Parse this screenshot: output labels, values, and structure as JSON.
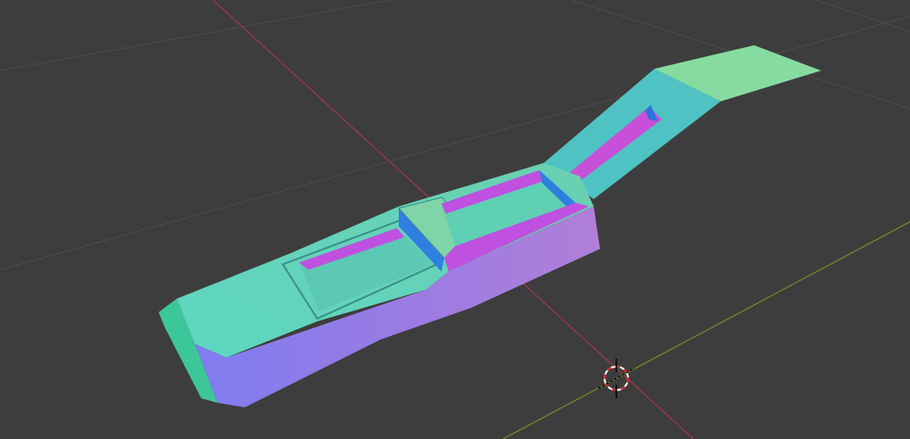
{
  "viewport": {
    "background": "#3d3d3d",
    "grid_color": "#4b4b4b",
    "x_axis_color": "#9a3a44",
    "y_axis_color": "#6b8a2c"
  },
  "model": {
    "shading": "normal-map",
    "top_color": "#62d0b8",
    "side_color": "#9a7be4",
    "wall_color": "#c050e0",
    "inner_blue": "#2f7fe0",
    "panel_color": "#86dca0"
  },
  "cursor": {
    "icon": "3d-cursor-icon"
  }
}
